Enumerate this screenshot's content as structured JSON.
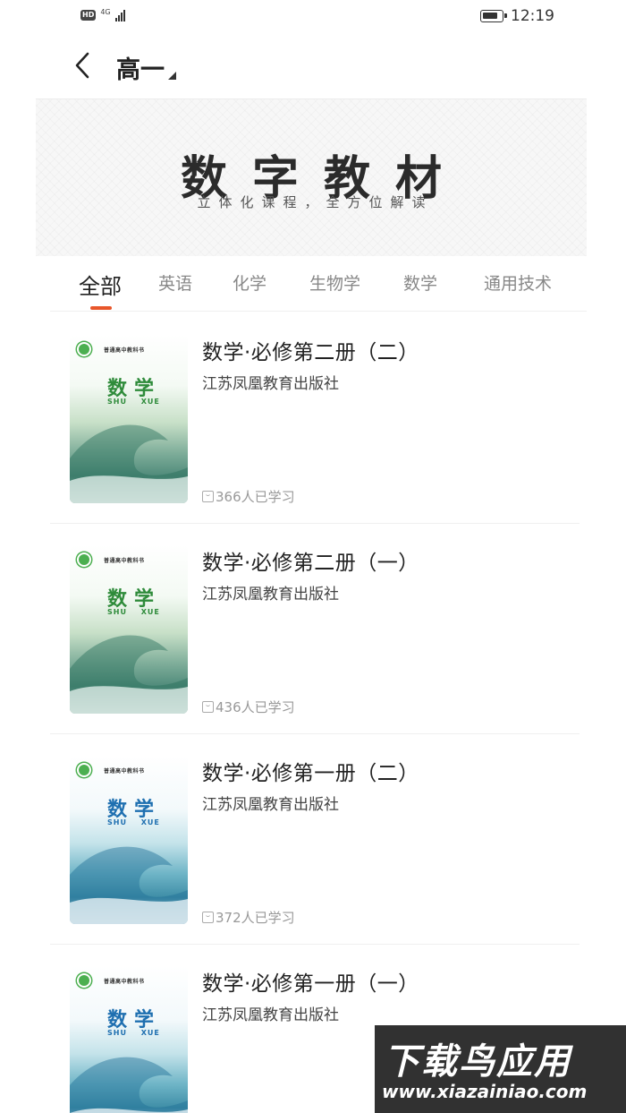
{
  "status_bar": {
    "hd": "HD",
    "network": "4G",
    "time": "12:19"
  },
  "header": {
    "title": "高一"
  },
  "banner": {
    "title": "数字教材",
    "subtitle": "立体化课程，全方位解读"
  },
  "tabs": [
    {
      "label": "全部"
    },
    {
      "label": "英语"
    },
    {
      "label": "化学"
    },
    {
      "label": "生物学"
    },
    {
      "label": "数学"
    },
    {
      "label": "通用技术"
    }
  ],
  "books": [
    {
      "title": "数学·必修第二册（二）",
      "publisher": "江苏凤凰教育出版社",
      "learners": "366人已学习",
      "cover": {
        "series": "普通高中教科书",
        "subject": "数学",
        "pinyin": "SHU XUE",
        "color": "green"
      }
    },
    {
      "title": "数学·必修第二册（一）",
      "publisher": "江苏凤凰教育出版社",
      "learners": "436人已学习",
      "cover": {
        "series": "普通高中教科书",
        "subject": "数学",
        "pinyin": "SHU XUE",
        "color": "green"
      }
    },
    {
      "title": "数学·必修第一册（二）",
      "publisher": "江苏凤凰教育出版社",
      "learners": "372人已学习",
      "cover": {
        "series": "普通高中教科书",
        "subject": "数学",
        "pinyin": "SHU XUE",
        "color": "blue"
      }
    },
    {
      "title": "数学·必修第一册（一）",
      "publisher": "江苏凤凰教育出版社",
      "learners": "",
      "cover": {
        "series": "普通高中教科书",
        "subject": "数学",
        "pinyin": "SHU XUE",
        "color": "blue"
      }
    }
  ],
  "watermark": {
    "text": "下载鸟应用",
    "url": "www.xiazainiao.com"
  },
  "colors": {
    "accent": "#e8562a",
    "green_cover": "#2e8b3a",
    "blue_cover": "#1e6fb0"
  }
}
